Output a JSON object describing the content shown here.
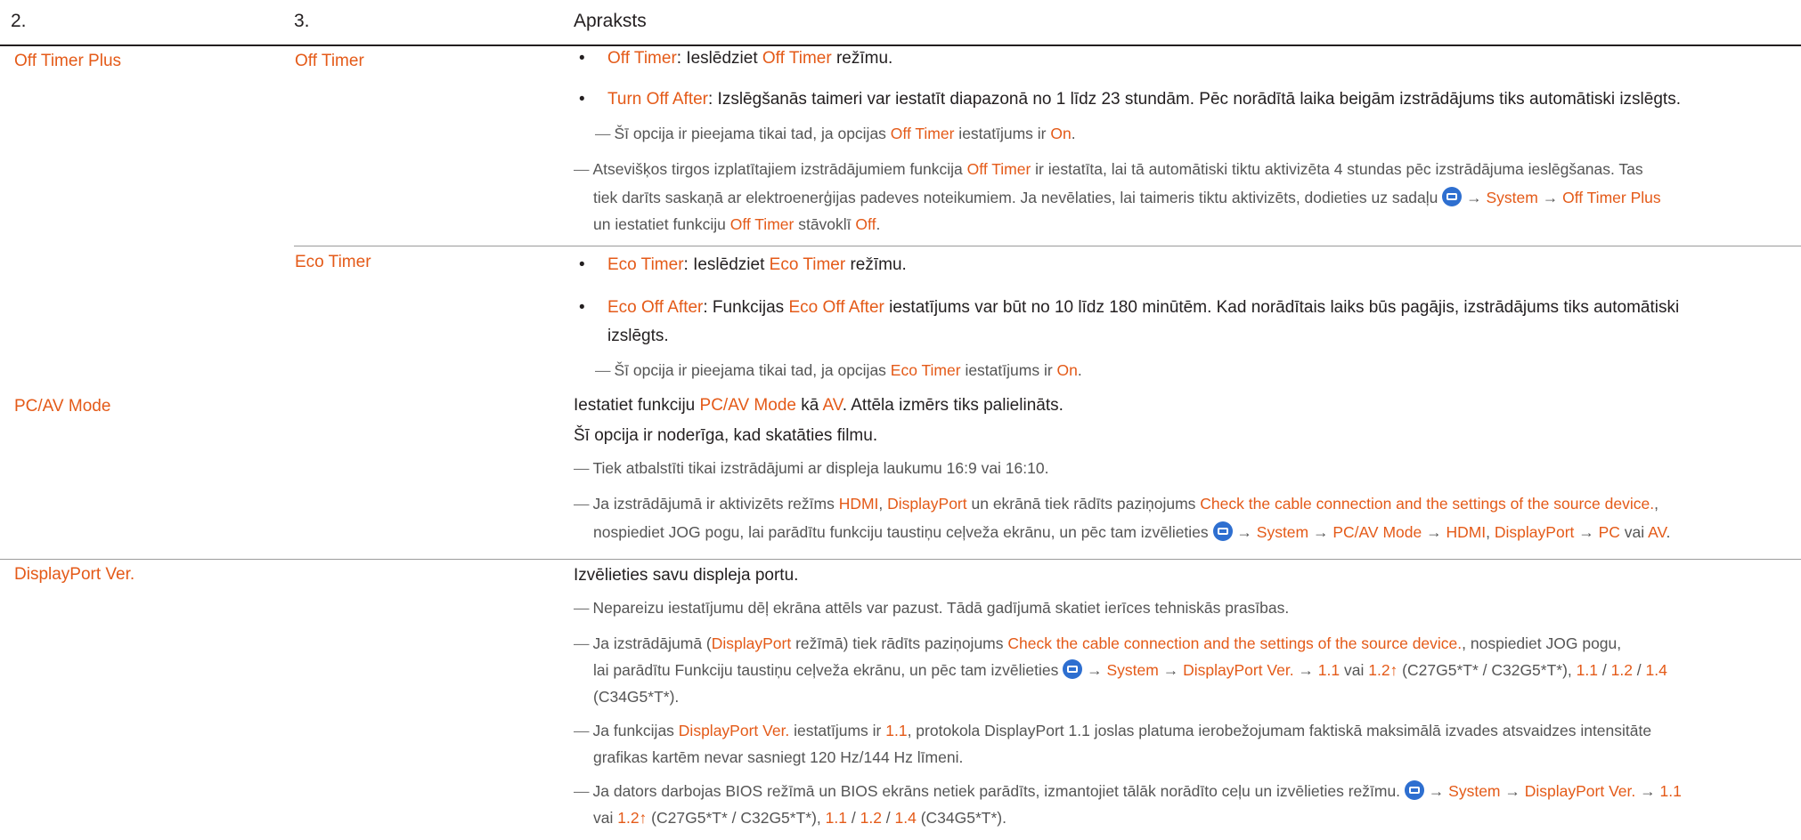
{
  "header": {
    "col1": "2.",
    "col2": "3.",
    "col3": "Apraksts"
  },
  "off_timer_plus": {
    "label": "Off Timer Plus",
    "off_timer": {
      "label": "Off Timer",
      "b1": {
        "kw": "Off Timer",
        "t1": ": Ieslēdziet ",
        "kw2": "Off Timer",
        "t2": " režīmu."
      },
      "b2": {
        "kw": "Turn Off After",
        "t1": ": Izslēgšanās taimeri var iestatīt diapazonā no 1 līdz 23 stundām. Pēc norādītā laika beigām izstrādājums tiks automātiski izslēgts."
      },
      "n1": {
        "dash": "―",
        "t1": "Šī opcija ir pieejama tikai tad, ja opcijas ",
        "kw": "Off Timer",
        "t2": " iestatījums ir ",
        "kw2": "On",
        "t3": "."
      },
      "n2": {
        "dash": "―",
        "l1a": "Atsevišķos tirgos izplatītajiem izstrādājumiem funkcija ",
        "l1kw": "Off Timer",
        "l1b": " ir iestatīta, lai tā automātiski tiktu aktivizēta 4 stundas pēc izstrādājuma ieslēgšanas. Tas",
        "l2a": "tiek darīts saskaņā ar elektroenerģijas padeves noteikumiem. Ja nevēlaties, lai taimeris tiktu aktivizēts, dodieties uz sadaļu ",
        "arrow": " → ",
        "l2kw1": "System",
        "l2kw2": "Off Timer Plus",
        "l3a": "un iestatiet funkciju ",
        "l3kw": "Off Timer",
        "l3b": " stāvoklī ",
        "l3kw2": "Off",
        "l3c": "."
      }
    },
    "eco_timer": {
      "label": "Eco Timer",
      "b1": {
        "kw": "Eco Timer",
        "t1": ": Ieslēdziet ",
        "kw2": "Eco Timer",
        "t2": " režīmu."
      },
      "b2": {
        "kw": "Eco Off After",
        "t1": ": Funkcijas ",
        "kw2": "Eco Off After",
        "t2": " iestatījums var būt no 10 līdz 180 minūtēm. Kad norādītais laiks būs pagājis, izstrādājums tiks automātiski",
        "t3": "izslēgts."
      },
      "n1": {
        "dash": "―",
        "t1": "Šī opcija ir pieejama tikai tad, ja opcijas ",
        "kw": "Eco Timer",
        "t2": " iestatījums ir ",
        "kw2": "On",
        "t3": "."
      }
    }
  },
  "pcav": {
    "label": "PC/AV Mode",
    "p1": {
      "t1": "Iestatiet funkciju ",
      "kw": "PC/AV Mode",
      "t2": " kā ",
      "kw2": "AV",
      "t3": ". Attēla izmērs tiks palielināts."
    },
    "p2": "Šī opcija ir noderīga, kad skatāties filmu.",
    "n1": {
      "dash": "―",
      "t": "Tiek atbalstīti tikai izstrādājumi ar displeja laukumu 16:9 vai 16:10."
    },
    "n2": {
      "dash": "―",
      "l1a": "Ja izstrādājumā ir aktivizēts režīms ",
      "kw1": "HDMI",
      "sep": ", ",
      "kw2": "DisplayPort",
      "l1b": " un ekrānā tiek rādīts paziņojums ",
      "kw3": "Check the cable connection and the settings of the source device.",
      "l1c": ",",
      "l2a": "nospiediet JOG pogu, lai parādītu funkciju taustiņu ceļveža ekrānu, un pēc tam izvēlieties ",
      "arrow": " → ",
      "kw4": "System",
      "kw5": "PC/AV Mode",
      "kw6": "HDMI",
      "kw7": "DisplayPort",
      "kw8": "PC",
      "vai": " vai ",
      "kw9": "AV",
      "end": "."
    }
  },
  "dp": {
    "label": "DisplayPort Ver.",
    "p1": "Izvēlieties savu displeja portu.",
    "n1": {
      "dash": "―",
      "t": "Nepareizu iestatījumu dēļ ekrāna attēls var pazust. Tādā gadījumā skatiet ierīces tehniskās prasības."
    },
    "n2": {
      "dash": "―",
      "l1a": "Ja izstrādājumā (",
      "kw1": "DisplayPort",
      "l1b": " režīmā) tiek rādīts paziņojums ",
      "kw2": "Check the cable connection and the settings of the source device.",
      "l1c": ", nospiediet JOG pogu,",
      "l2a": "lai parādītu Funkciju taustiņu ceļveža ekrānu, un pēc tam izvēlieties ",
      "arrow": " → ",
      "kw3": "System",
      "kw4": "DisplayPort Ver.",
      "kw5": "1.1",
      "vai": " vai ",
      "kw6": "1.2↑",
      "m1": " (C27G5*T* / C32G5*T*), ",
      "kw7": "1.1",
      "sl": " / ",
      "kw8": "1.2",
      "kw9": "1.4",
      "l3": "(C34G5*T*)."
    },
    "n3": {
      "dash": "―",
      "l1a": "Ja funkcijas ",
      "kw1": "DisplayPort Ver.",
      "l1b": " iestatījums ir ",
      "kw2": "1.1",
      "l1c": ", protokola DisplayPort 1.1 joslas platuma ierobežojumam faktiskā maksimālā izvades atsvaidzes intensitāte",
      "l2": "grafikas kartēm nevar sasniegt 120 Hz/144 Hz līmeni."
    },
    "n4": {
      "dash": "―",
      "l1a": "Ja dators darbojas BIOS režīmā un BIOS ekrāns netiek parādīts, izmantojiet tālāk norādīto ceļu un izvēlieties režīmu. ",
      "arrow": " → ",
      "kw1": "System",
      "kw2": "DisplayPort Ver.",
      "kw3": "1.1",
      "vai": "vai ",
      "kw4": "1.2↑",
      "m1": " (C27G5*T* / C32G5*T*), ",
      "kw5": "1.1",
      "sl": " / ",
      "kw6": "1.2",
      "kw7": "1.4",
      "m2": " (C34G5*T*)."
    }
  }
}
